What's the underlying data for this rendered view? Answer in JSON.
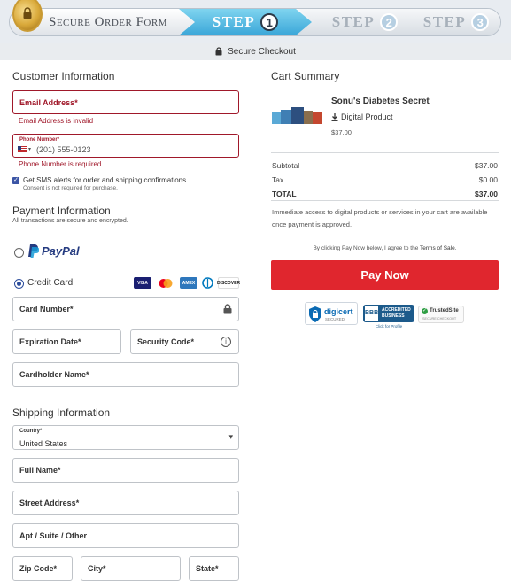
{
  "header": {
    "form_title": "Secure Order Form",
    "steps": [
      {
        "label": "STEP",
        "number": "1",
        "active": true
      },
      {
        "label": "STEP",
        "number": "2",
        "active": false
      },
      {
        "label": "STEP",
        "number": "3",
        "active": false
      }
    ],
    "secure_checkout": "Secure Checkout"
  },
  "customer": {
    "title": "Customer Information",
    "email_label": "Email Address*",
    "email_error": "Email Address is invalid",
    "phone_label": "Phone Number*",
    "phone_country_flag": "US",
    "phone_placeholder": "(201) 555-0123",
    "phone_error": "Phone Number is required",
    "sms_label": "Get SMS alerts for order and shipping confirmations.",
    "sms_note": "Consent is not required for purchase.",
    "sms_checked": true
  },
  "payment": {
    "title": "Payment Information",
    "subtitle": "All transactions are secure and encrypted.",
    "paypal_label": "PayPal",
    "credit_label": "Credit Card",
    "card_brands": [
      "VISA",
      "mastercard",
      "AMEX",
      "diners",
      "DISCOVER"
    ],
    "card_number_label": "Card Number*",
    "expiration_label": "Expiration Date*",
    "security_label": "Security Code*",
    "cardholder_label": "Cardholder Name*"
  },
  "shipping": {
    "title": "Shipping Information",
    "country_label": "Country*",
    "country_value": "United States",
    "full_name_label": "Full Name*",
    "street_label": "Street Address*",
    "apt_label": "Apt / Suite / Other",
    "zip_label": "Zip Code*",
    "city_label": "City*",
    "state_label": "State*"
  },
  "cart": {
    "title": "Cart Summary",
    "product_name": "Sonu's Diabetes Secret",
    "product_type": "Digital Product",
    "product_price": "$37.00",
    "subtotal_label": "Subtotal",
    "subtotal_value": "$37.00",
    "tax_label": "Tax",
    "tax_value": "$0.00",
    "total_label": "TOTAL",
    "total_value": "$37.00",
    "access_note": "Immediate access to digital products or services in your cart are available once payment is approved.",
    "terms_prefix": "By clicking Pay Now below, I agree to the ",
    "terms_link": "Terms of Sale",
    "terms_suffix": ".",
    "pay_button": "Pay Now"
  },
  "trust": {
    "digicert": "digicert",
    "digicert_sub": "SECURED",
    "bbb_line1": "ACCREDITED",
    "bbb_line2": "BUSINESS",
    "bbb_caption": "Click for Profile",
    "trustedsite": "TrustedSite",
    "trustedsite_sub": "SECURE CHECKOUT"
  },
  "colors": {
    "error": "#a0182a",
    "pay_button": "#e0262e",
    "step_active": "#3aa6d8",
    "paypal_dark": "#253b80",
    "paypal_light": "#179bd7"
  }
}
